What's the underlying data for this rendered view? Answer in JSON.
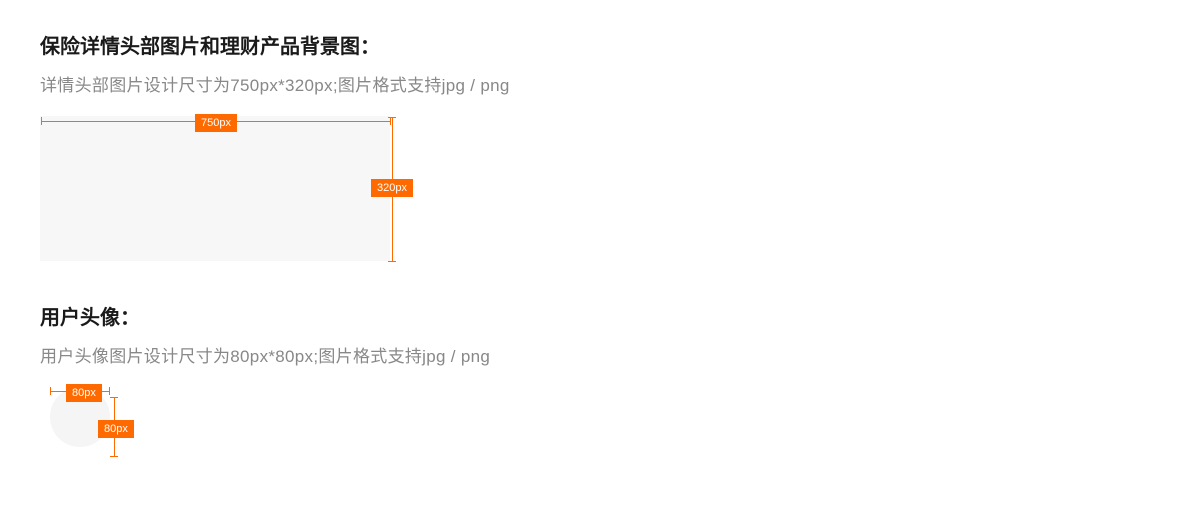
{
  "section1": {
    "title": "保险详情头部图片和理财产品背景图：",
    "desc": "详情头部图片设计尺寸为750px*320px;图片格式支持jpg / png",
    "width_label": "750px",
    "height_label": "320px"
  },
  "section2": {
    "title": "用户头像：",
    "desc": "用户头像图片设计尺寸为80px*80px;图片格式支持jpg / png",
    "width_label": "80px",
    "height_label": "80px"
  },
  "colors": {
    "accent": "#ff6a00",
    "text_primary": "#1a1a1a",
    "text_secondary": "#888888",
    "placeholder_bg": "#f7f7f7"
  }
}
